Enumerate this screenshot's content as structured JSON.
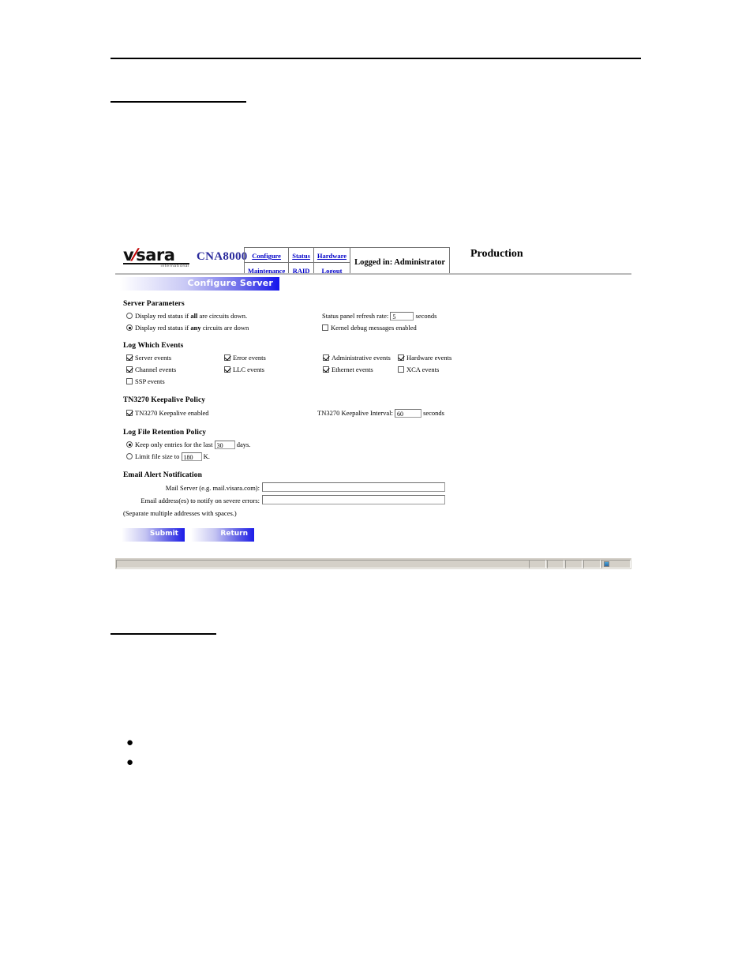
{
  "app": {
    "logo": {
      "brand": "v",
      "brand_rest": "sara",
      "tagline": "international"
    },
    "model": "CNA8000",
    "machine_name": "Production",
    "login_status": "Logged in: Administrator",
    "nav": {
      "row1": [
        "Configure",
        "Status",
        "Hardware"
      ],
      "row2": [
        "Maintenance",
        "RAID",
        "Logout"
      ]
    },
    "page_title": "Configure Server"
  },
  "server_parameters": {
    "heading": "Server Parameters",
    "radio_all_pre": "Display red status if ",
    "radio_all_bold": "all",
    "radio_all_post": " are circuits down.",
    "radio_any_pre": "Display red status if ",
    "radio_any_bold": "any",
    "radio_any_post": " circuits are down",
    "radio_all_selected": false,
    "radio_any_selected": true,
    "refresh_label": "Status panel refresh rate:",
    "refresh_value": "5",
    "refresh_units": "seconds",
    "kernel_debug_label": "Kernel debug messages enabled",
    "kernel_debug_checked": false
  },
  "log_events": {
    "heading": "Log Which Events",
    "items": [
      {
        "label": "Server events",
        "checked": true
      },
      {
        "label": "Error events",
        "checked": true
      },
      {
        "label": "Administrative events",
        "checked": true
      },
      {
        "label": "Hardware events",
        "checked": true
      },
      {
        "label": "Channel events",
        "checked": true
      },
      {
        "label": "LLC events",
        "checked": true
      },
      {
        "label": "Ethernet events",
        "checked": true
      },
      {
        "label": "XCA events",
        "checked": false
      },
      {
        "label": "SSP events",
        "checked": false
      }
    ]
  },
  "keepalive": {
    "heading": "TN3270 Keepalive Policy",
    "enabled_label": "TN3270 Keepalive enabled",
    "enabled_checked": true,
    "interval_label": "TN3270 Keepalive Interval:",
    "interval_value": "60",
    "interval_units": "seconds"
  },
  "retention": {
    "heading": "Log File Retention Policy",
    "keep_label_pre": "Keep only entries for the last",
    "keep_value": "30",
    "keep_label_post": "days.",
    "keep_selected": true,
    "limit_label_pre": "Limit file size to",
    "limit_value": "180",
    "limit_label_post": "K.",
    "limit_selected": false
  },
  "email": {
    "heading": "Email Alert Notification",
    "mail_server_label": "Mail Server (e.g. mail.visara.com):",
    "mail_server_value": "",
    "notify_label": "Email address(es) to notify on severe errors:",
    "notify_value": "",
    "note": "(Separate multiple addresses with spaces.)"
  },
  "actions": {
    "submit_label": "Submit",
    "return_label": "Return"
  },
  "colors": {
    "accent_blue": "#1414ec",
    "link_blue": "#0000c8",
    "model_blue": "#2b2b9c",
    "logo_red": "#c00000",
    "chrome_gray": "#d4d0c8"
  }
}
